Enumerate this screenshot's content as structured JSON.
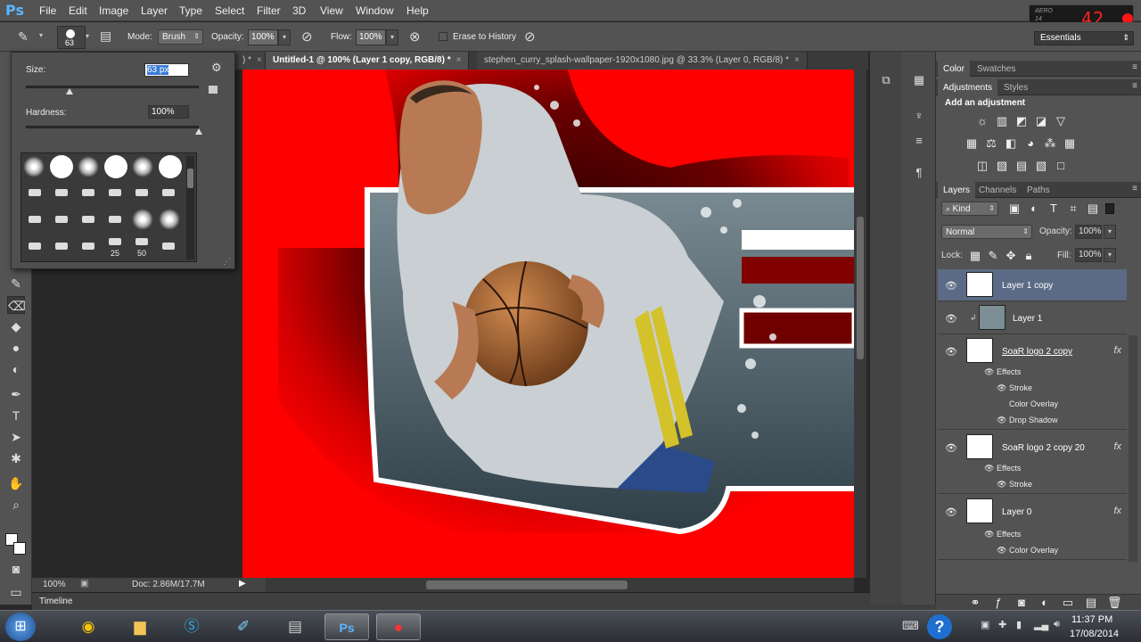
{
  "menubar": {
    "app_icon": "Ps",
    "items": [
      "File",
      "Edit",
      "Image",
      "Layer",
      "Type",
      "Select",
      "Filter",
      "3D",
      "View",
      "Window",
      "Help"
    ]
  },
  "aero_widget": {
    "label": "AERO",
    "sub_label": "14",
    "number": "42"
  },
  "optionsbar": {
    "brush_size": "63",
    "mode_label": "Mode:",
    "mode_value": "Brush",
    "opacity_label": "Opacity:",
    "opacity_value": "100%",
    "flow_label": "Flow:",
    "flow_value": "100%",
    "erase_history_label": "Erase to History",
    "workspace": "Essentials"
  },
  "brush_popup": {
    "size_label": "Size:",
    "size_value": "63 px",
    "size_level": 0.25,
    "hardness_label": "Hardness:",
    "hardness_value": "100%",
    "hardness_level": 1.0,
    "preset_numbers": [
      "25",
      "50"
    ]
  },
  "doc_tabs": [
    {
      "label": ") *",
      "close": "×",
      "active": false
    },
    {
      "label": "Untitled-1 @ 100% (Layer 1 copy, RGB/8) *",
      "close": "×",
      "active": true
    },
    {
      "label": "stephen_curry_splash-wallpaper-1920x1080.jpg @ 33.3% (Layer 0, RGB/8) *",
      "close": "×",
      "active": false
    }
  ],
  "status": {
    "zoom": "100%",
    "doc": "Doc: 2.86M/17.7M"
  },
  "timeline_label": "Timeline",
  "panels": {
    "color_tabs": [
      "Color",
      "Swatches"
    ],
    "adjust_tabs": [
      "Adjustments",
      "Styles"
    ],
    "adjust_title": "Add an adjustment",
    "layers_tabs": [
      "Layers",
      "Channels",
      "Paths"
    ],
    "kind_label": "Kind",
    "blend_mode": "Normal",
    "opacity_label": "Opacity:",
    "opacity_value": "100%",
    "lock_label": "Lock:",
    "fill_label": "Fill:",
    "fill_value": "100%"
  },
  "layers": [
    {
      "name": "Layer 1 copy",
      "selected": true
    },
    {
      "name": "Layer 1",
      "selected": false
    },
    {
      "name": "SoaR logo 2 copy",
      "selected": false,
      "effects_label": "Effects",
      "effects": [
        "Stroke",
        "Color Overlay",
        "Drop Shadow"
      ]
    },
    {
      "name": "SoaR logo 2 copy 20",
      "selected": false,
      "effects_label": "Effects",
      "effects": [
        "Stroke"
      ]
    },
    {
      "name": "Layer 0",
      "selected": false,
      "effects_label": "Effects",
      "effects": [
        "Color Overlay"
      ]
    }
  ],
  "fx_label": "fx",
  "taskbar": {
    "time": "11:37 PM",
    "date": "17/08/2014"
  },
  "colors": {
    "panel": "#535353",
    "canvas_red": "#ff0000",
    "selected_layer": "#5b6b85"
  }
}
